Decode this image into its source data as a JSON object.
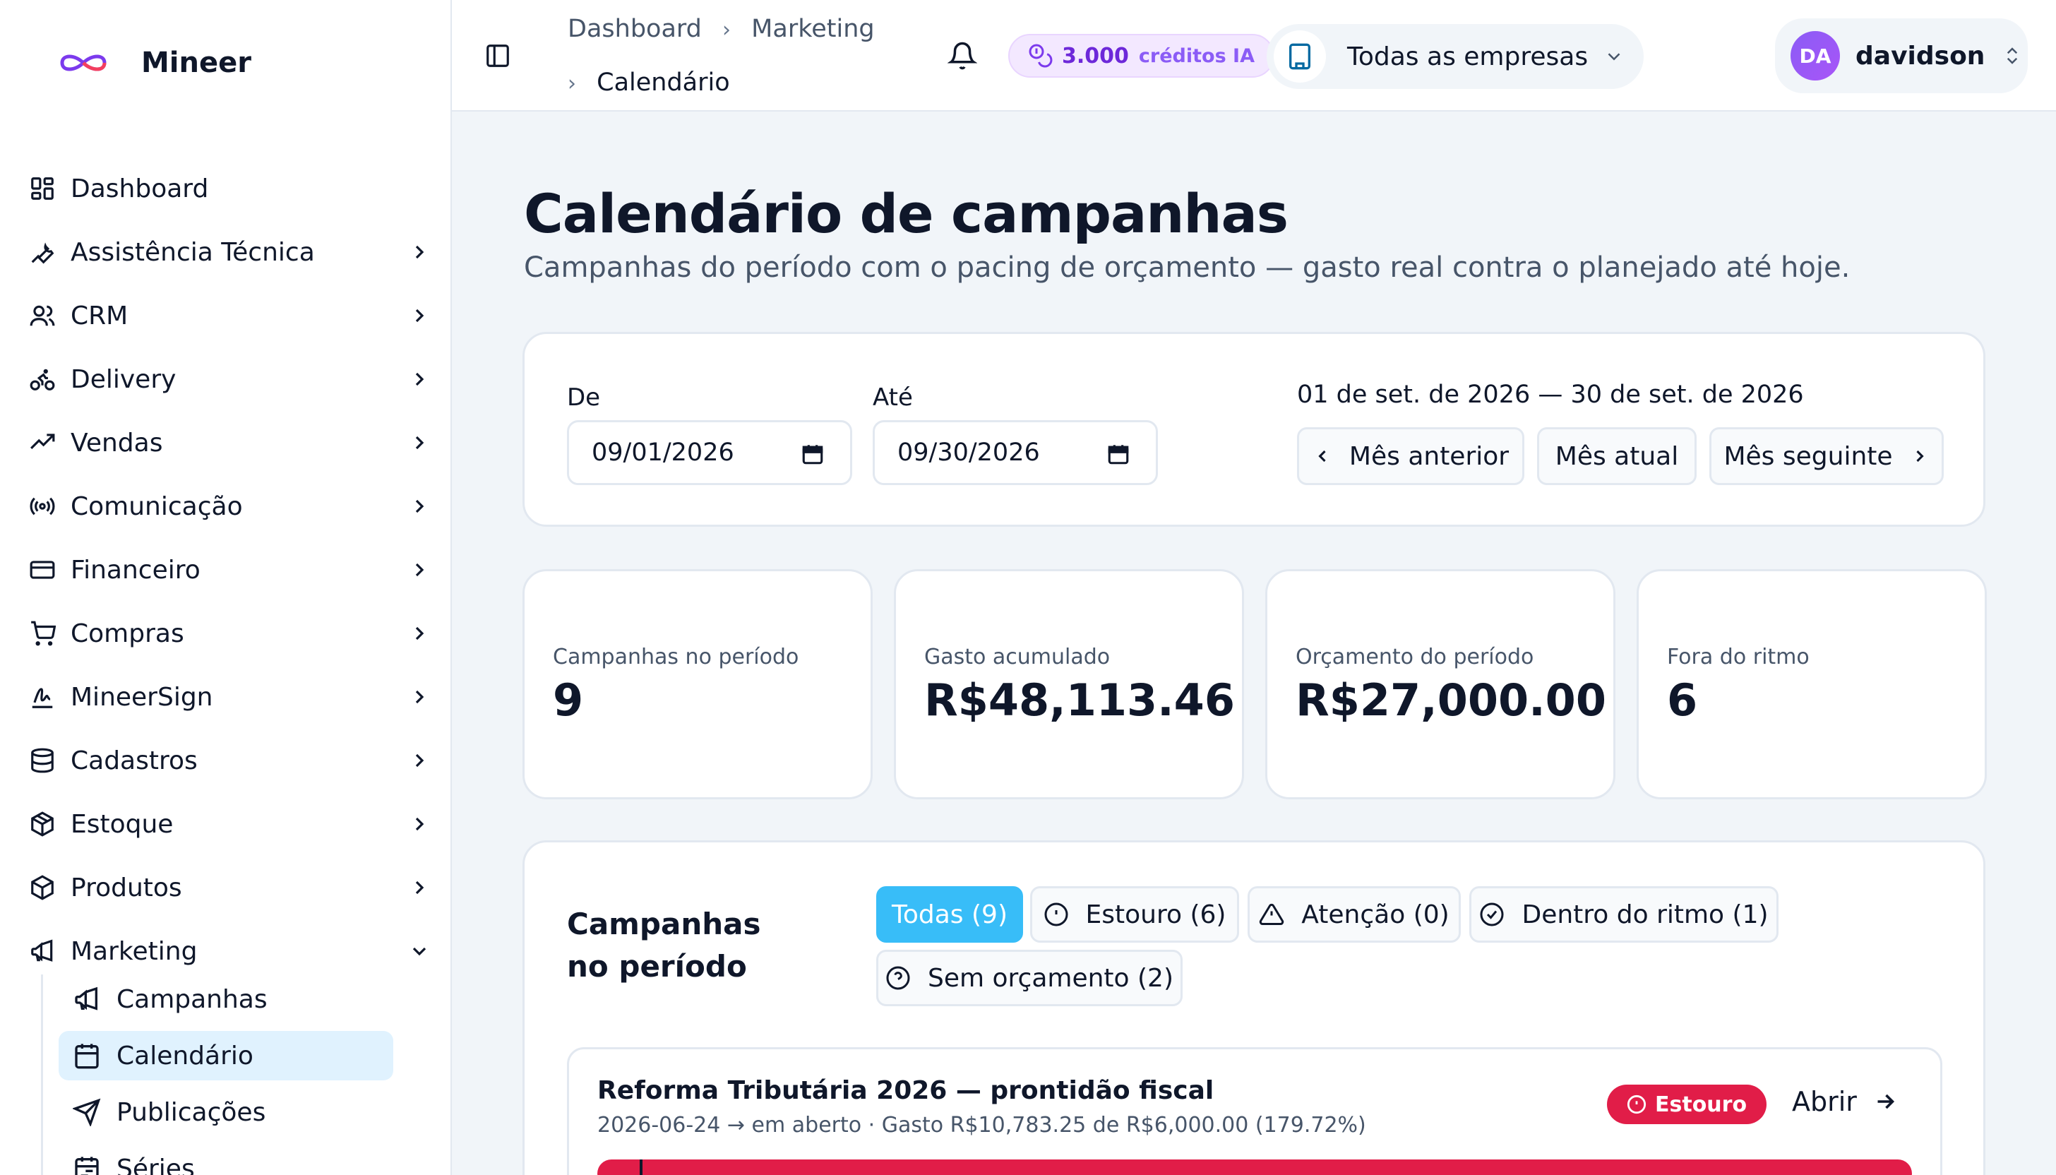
{
  "brand": {
    "name": "Mineer"
  },
  "sidebar": {
    "items": [
      {
        "label": "Dashboard",
        "icon": "dashboard-icon",
        "has_children": false
      },
      {
        "label": "Assistência Técnica",
        "icon": "wrench-icon",
        "has_children": true
      },
      {
        "label": "CRM",
        "icon": "users-icon",
        "has_children": true
      },
      {
        "label": "Delivery",
        "icon": "bike-icon",
        "has_children": true
      },
      {
        "label": "Vendas",
        "icon": "trending-up-icon",
        "has_children": true
      },
      {
        "label": "Comunicação",
        "icon": "radio-icon",
        "has_children": true
      },
      {
        "label": "Financeiro",
        "icon": "credit-card-icon",
        "has_children": true
      },
      {
        "label": "Compras",
        "icon": "cart-icon",
        "has_children": true
      },
      {
        "label": "MineerSign",
        "icon": "signature-icon",
        "has_children": true
      },
      {
        "label": "Cadastros",
        "icon": "database-icon",
        "has_children": true
      },
      {
        "label": "Estoque",
        "icon": "package-icon",
        "has_children": true
      },
      {
        "label": "Produtos",
        "icon": "box-icon",
        "has_children": true
      },
      {
        "label": "Marketing",
        "icon": "megaphone-icon",
        "has_children": true,
        "expanded": true
      }
    ],
    "sub_items": [
      {
        "label": "Campanhas",
        "icon": "megaphone-icon"
      },
      {
        "label": "Calendário",
        "icon": "calendar-icon",
        "active": true
      },
      {
        "label": "Publicações",
        "icon": "send-icon"
      },
      {
        "label": "Séries",
        "icon": "calendar-range-icon"
      }
    ]
  },
  "topbar": {
    "breadcrumb": [
      "Dashboard",
      "Marketing",
      "Calendário"
    ],
    "credits": {
      "value": "3.000",
      "label": "créditos IA"
    },
    "company": "Todas as empresas",
    "user": {
      "initials": "DA",
      "name": "davidson"
    }
  },
  "page": {
    "title": "Calendário de campanhas",
    "subtitle": "Campanhas do período com o pacing de orçamento — gasto real contra o planejado até hoje."
  },
  "filters": {
    "from_label": "De",
    "from_value": "09/01/2026",
    "to_label": "Até",
    "to_value": "09/30/2026",
    "range_text": "01 de set. de 2026 — 30 de set. de 2026",
    "prev_label": "Mês anterior",
    "current_label": "Mês atual",
    "next_label": "Mês seguinte"
  },
  "stats": [
    {
      "label": "Campanhas no período",
      "value": "9"
    },
    {
      "label": "Gasto acumulado",
      "value": "R$48,113.46"
    },
    {
      "label": "Orçamento do período",
      "value": "R$27,000.00"
    },
    {
      "label": "Fora do ritmo",
      "value": "6"
    }
  ],
  "list": {
    "title": "Campanhas no período",
    "chips": [
      {
        "label": "Todas (9)",
        "active": true
      },
      {
        "label": "Estouro (6)",
        "icon": "alert-circle-icon"
      },
      {
        "label": "Atenção (0)",
        "icon": "alert-triangle-icon"
      },
      {
        "label": "Dentro do ritmo (1)",
        "icon": "check-circle-icon"
      },
      {
        "label": "Sem orçamento (2)",
        "icon": "help-circle-icon"
      }
    ],
    "campaigns": [
      {
        "name": "Reforma Tributária 2026 — prontidão fiscal",
        "meta": "2026-06-24 → em aberto · Gasto R$10,783.25 de R$6,000.00 (179.72%)",
        "badge": "Estouro",
        "open_label": "Abrir",
        "pacing_percent": 179.72
      }
    ]
  },
  "colors": {
    "accent": "#38bdf8",
    "danger": "#e11d48",
    "purple": "#8b5cf6"
  }
}
